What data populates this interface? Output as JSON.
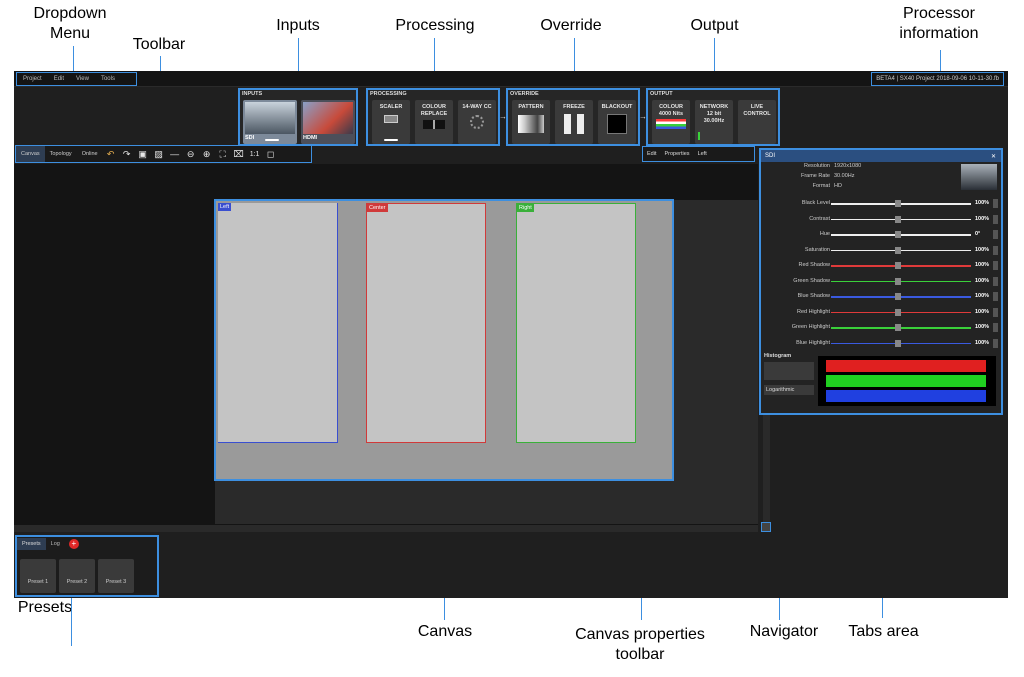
{
  "callouts": {
    "dropdown_menu": "Dropdown Menu",
    "toolbar": "Toolbar",
    "inputs": "Inputs",
    "processing": "Processing",
    "override": "Override",
    "output": "Output",
    "processor_information": "Processor information",
    "presets": "Presets",
    "canvas": "Canvas",
    "canvas_properties_toolbar": "Canvas properties toolbar",
    "navigator": "Navigator",
    "tabs_area": "Tabs area"
  },
  "menu": {
    "items": [
      "Project",
      "Edit",
      "View",
      "Tools"
    ]
  },
  "processor_info": "BETA4 | SX40 Project 2018-09-06 10-11-30.fb",
  "inputs": {
    "title": "INPUTS",
    "cards": [
      "SDI",
      "HDMI"
    ]
  },
  "processing": {
    "title": "PROCESSING",
    "cards": [
      "SCALER",
      "COLOUR REPLACE",
      "14-WAY CC"
    ]
  },
  "override": {
    "title": "OVERRIDE",
    "cards": [
      "PATTERN",
      "FREEZE",
      "BLACKOUT"
    ]
  },
  "output": {
    "title": "OUTPUT",
    "cards": [
      "COLOUR\n4000 Nits",
      "NETWORK\n12 bit\n30.00Hz",
      "LIVE CONTROL"
    ]
  },
  "toolbar": {
    "tabs": [
      "Canvas",
      "Topology",
      "Online"
    ],
    "icons": [
      "undo-icon",
      "redo-icon",
      "add-layer-icon",
      "add-region-icon",
      "line-icon",
      "zoom-out-icon",
      "zoom-in-icon",
      "fit-icon",
      "shrink-icon",
      "actual-size-icon",
      "frame-icon"
    ],
    "one_to_one": "1:1"
  },
  "canvas": {
    "panels": [
      "Left",
      "Center",
      "Right"
    ]
  },
  "props_toolbar": {
    "edit": "Edit",
    "properties": "Properties",
    "left": "Left"
  },
  "tabs_area": {
    "title": "SDI",
    "info": [
      {
        "label": "Resolution",
        "value": "1920x1080"
      },
      {
        "label": "Frame Rate",
        "value": "30.00Hz"
      },
      {
        "label": "Format",
        "value": "HD"
      }
    ],
    "sliders": [
      {
        "label": "Black Level",
        "value": "100%",
        "color": "#eeeeee"
      },
      {
        "label": "Contrast",
        "value": "100%",
        "color": "#eeeeee"
      },
      {
        "label": "Hue",
        "value": "0°",
        "color": "#eeeeee"
      },
      {
        "label": "Saturation",
        "value": "100%",
        "color": "#eeeeee"
      },
      {
        "label": "Red Shadow",
        "value": "100%",
        "color": "#e03a3a"
      },
      {
        "label": "Green Shadow",
        "value": "100%",
        "color": "#3ad03a"
      },
      {
        "label": "Blue Shadow",
        "value": "100%",
        "color": "#3a5ae0"
      },
      {
        "label": "Red Highlight",
        "value": "100%",
        "color": "#e03a3a"
      },
      {
        "label": "Green Highlight",
        "value": "100%",
        "color": "#3ad03a"
      },
      {
        "label": "Blue Highlight",
        "value": "100%",
        "color": "#3a5ae0"
      }
    ],
    "histogram_label": "Histogram",
    "histogram_mode": "Logarithmic"
  },
  "presets": {
    "tabs": [
      "Presets",
      "Log"
    ],
    "items": [
      "Preset 1",
      "Preset 2",
      "Preset 3"
    ]
  },
  "colors": {
    "accent": "#3d8fe0",
    "left": "#3a4fd0",
    "center": "#d03a3a",
    "right": "#3ab03a"
  }
}
